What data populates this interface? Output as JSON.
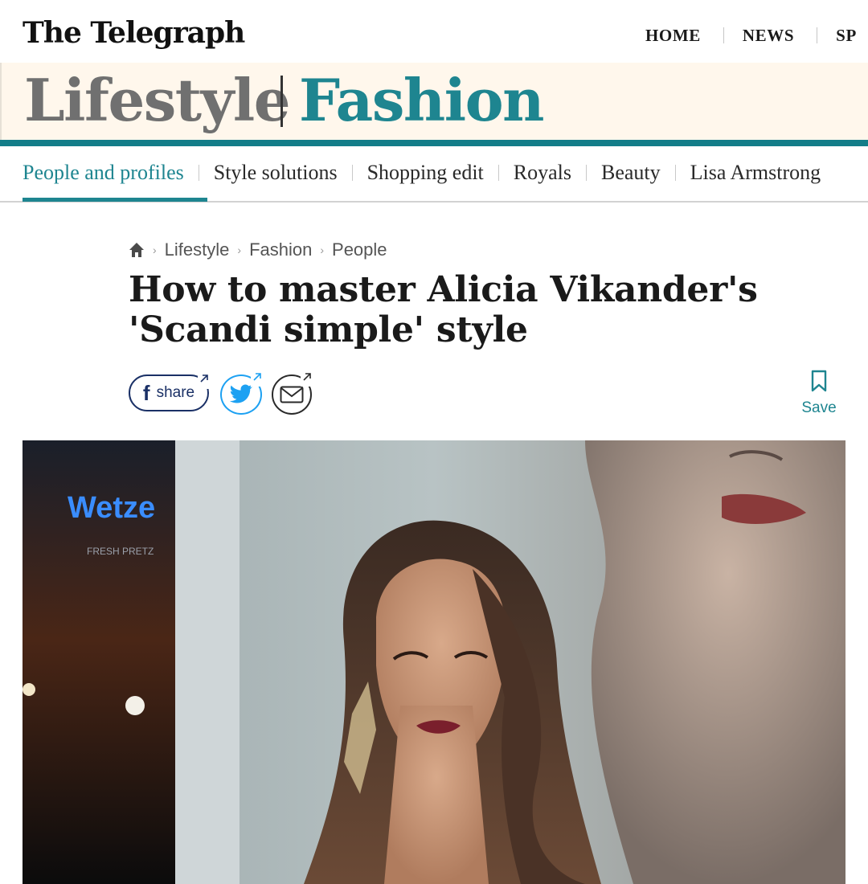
{
  "header": {
    "logo_text": "The Telegraph",
    "nav": [
      "HOME",
      "NEWS",
      "SP"
    ]
  },
  "section": {
    "parent": "Lifestyle",
    "name": "Fashion",
    "accent_color": "#1e8590",
    "band_color": "#fff7ec"
  },
  "subnav": [
    "People and profiles",
    "Style solutions",
    "Shopping edit",
    "Royals",
    "Beauty",
    "Lisa Armstrong"
  ],
  "breadcrumb": {
    "home_icon": "home-icon",
    "items": [
      "Lifestyle",
      "Fashion",
      "People"
    ]
  },
  "article": {
    "headline": "How to master Alicia Vikander's 'Scandi simple' style"
  },
  "share": {
    "facebook_label": "share",
    "save_label": "Save"
  },
  "hero": {
    "sign_text": "Wetze",
    "sign_subtext": "FRESH PRETZ"
  }
}
